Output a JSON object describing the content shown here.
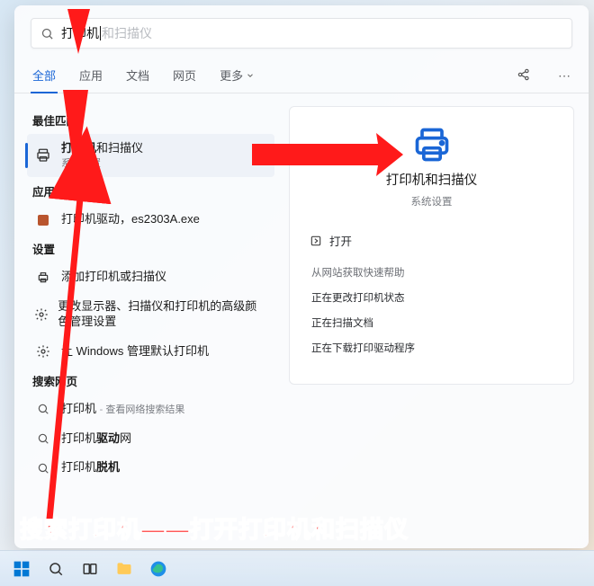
{
  "search": {
    "typed": "打印机",
    "ghost": "和扫描仪"
  },
  "tabs": {
    "all": "全部",
    "apps": "应用",
    "docs": "文档",
    "web": "网页",
    "more": "更多"
  },
  "left": {
    "best_match": "最佳匹配",
    "top": {
      "title": "打印机和扫描仪",
      "sub": "系统设置"
    },
    "apps_hdr": "应用",
    "app1": "打印机驱动，es2303A.exe",
    "settings_hdr": "设置",
    "s1": "添加打印机或扫描仪",
    "s2": "更改显示器、扫描仪和打印机的高级颜色管理设置",
    "s3": "让 Windows 管理默认打印机",
    "web_hdr": "搜索网页",
    "w1": "打印机",
    "w1_hint": "查看网络搜索结果",
    "w2": "打印机驱动网",
    "w3": "打印机脱机"
  },
  "panel": {
    "title": "打印机和扫描仪",
    "sub": "系统设置",
    "open": "打开",
    "help_hdr": "从网站获取快速帮助",
    "h1": "正在更改打印机状态",
    "h2": "正在扫描文档",
    "h3": "正在下载打印驱动程序"
  },
  "annotation": {
    "caption": "搜索打印机——打开打印机和扫描仪"
  }
}
